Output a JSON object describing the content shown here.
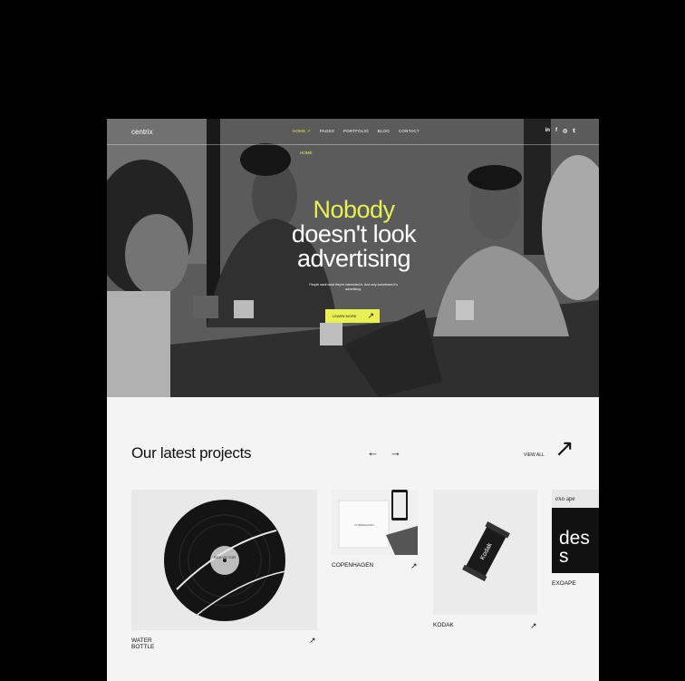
{
  "nav": {
    "logo": "centrix",
    "items": [
      "HOME ↗",
      "PAGES",
      "PORTFOLIO",
      "BLOG",
      "CONTACT"
    ],
    "submenu": "HOME",
    "social": [
      "in",
      "f",
      "◎",
      "𝕥"
    ]
  },
  "hero": {
    "title_highlight": "Nobody",
    "title_line2": "doesn't look",
    "title_line3": "advertising",
    "subtitle": "People want what they're interested in. And only sometimes it's advertising.",
    "cta_label": "LEARN MORE",
    "cta_arrow": "↗"
  },
  "projects": {
    "title": "Our latest projects",
    "prev_arrow": "←",
    "next_arrow": "→",
    "view_all": "VIEW ALL",
    "view_all_arrow": "↗",
    "items": [
      {
        "name": "WATER BOTTLE",
        "arrow": "↗",
        "label_on_image": "RCA VICTOR"
      },
      {
        "name": "COPENHAGEN",
        "arrow": "↗",
        "label_on_image": "COPENHAGEN"
      },
      {
        "name": "KODAK",
        "arrow": "↗",
        "label_on_image": "Kodak"
      },
      {
        "name": "EXOAPE",
        "arrow": "",
        "label_on_image": "exo ape",
        "big_text": "des s"
      }
    ]
  },
  "colors": {
    "accent": "#e8f055",
    "background": "#000000",
    "page": "#f4f4f4"
  }
}
